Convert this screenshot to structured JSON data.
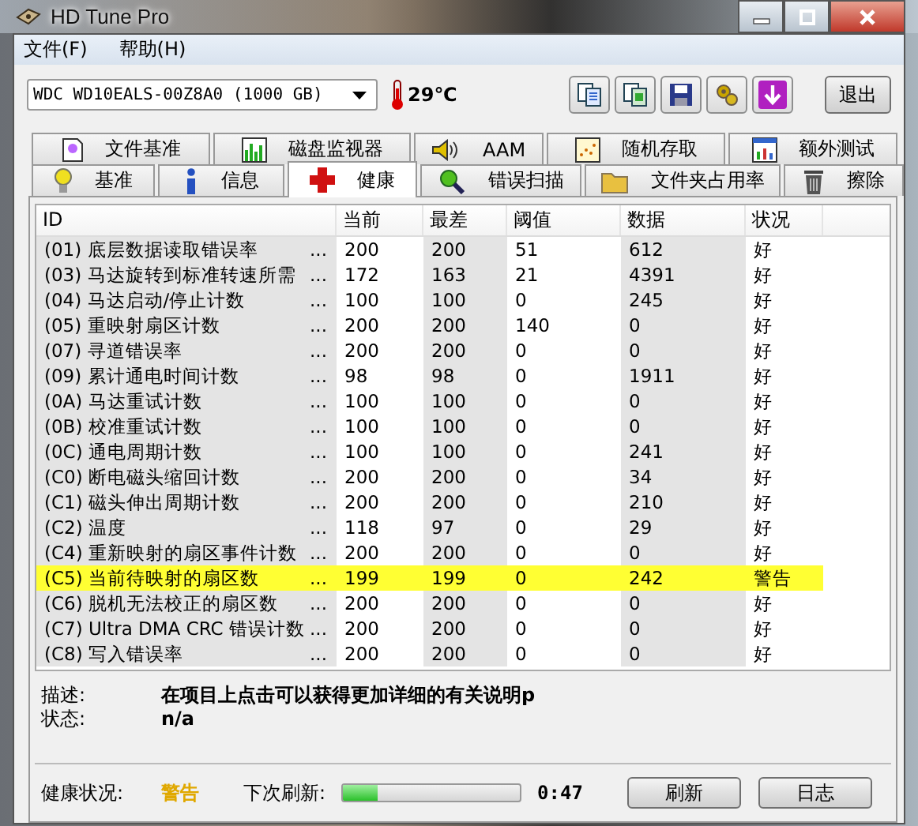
{
  "window": {
    "title": "HD Tune Pro"
  },
  "menu": [
    "文件(F)",
    "帮助(H)"
  ],
  "drive": {
    "value": "WDC WD10EALS-00Z8A0 (1000 GB)"
  },
  "temperature": "29℃",
  "exit_button": "退出",
  "tab_rows": [
    [
      {
        "label": "文件基准",
        "selected": false
      },
      {
        "label": "磁盘监视器",
        "selected": false
      },
      {
        "label": "AAM",
        "selected": false
      },
      {
        "label": "随机存取",
        "selected": false
      },
      {
        "label": "额外测试",
        "selected": false
      }
    ],
    [
      {
        "label": "基准",
        "selected": false
      },
      {
        "label": "信息",
        "selected": false
      },
      {
        "label": "健康",
        "selected": true
      },
      {
        "label": "错误扫描",
        "selected": false
      },
      {
        "label": "文件夹占用率",
        "selected": false
      },
      {
        "label": "擦除",
        "selected": false
      }
    ]
  ],
  "table": {
    "columns": [
      "ID",
      "当前",
      "最差",
      "阈值",
      "数据",
      "状况"
    ],
    "rows": [
      {
        "id": "(01) 底层数据读取错误率",
        "more": "...",
        "current": "200",
        "worst": "200",
        "threshold": "51",
        "data": "612",
        "status": "好",
        "warning": false
      },
      {
        "id": "(03) 马达旋转到标准转速所需",
        "more": "...",
        "current": "172",
        "worst": "163",
        "threshold": "21",
        "data": "4391",
        "status": "好",
        "warning": false
      },
      {
        "id": "(04) 马达启动/停止计数",
        "more": "...",
        "current": "100",
        "worst": "100",
        "threshold": "0",
        "data": "245",
        "status": "好",
        "warning": false
      },
      {
        "id": "(05) 重映射扇区计数",
        "more": "...",
        "current": "200",
        "worst": "200",
        "threshold": "140",
        "data": "0",
        "status": "好",
        "warning": false
      },
      {
        "id": "(07) 寻道错误率",
        "more": "...",
        "current": "200",
        "worst": "200",
        "threshold": "0",
        "data": "0",
        "status": "好",
        "warning": false
      },
      {
        "id": "(09) 累计通电时间计数",
        "more": "...",
        "current": "98",
        "worst": "98",
        "threshold": "0",
        "data": "1911",
        "status": "好",
        "warning": false
      },
      {
        "id": "(0A) 马达重试计数",
        "more": "...",
        "current": "100",
        "worst": "100",
        "threshold": "0",
        "data": "0",
        "status": "好",
        "warning": false
      },
      {
        "id": "(0B) 校准重试计数",
        "more": "...",
        "current": "100",
        "worst": "100",
        "threshold": "0",
        "data": "0",
        "status": "好",
        "warning": false
      },
      {
        "id": "(0C) 通电周期计数",
        "more": "...",
        "current": "100",
        "worst": "100",
        "threshold": "0",
        "data": "241",
        "status": "好",
        "warning": false
      },
      {
        "id": "(C0) 断电磁头缩回计数",
        "more": "...",
        "current": "200",
        "worst": "200",
        "threshold": "0",
        "data": "34",
        "status": "好",
        "warning": false
      },
      {
        "id": "(C1) 磁头伸出周期计数",
        "more": "...",
        "current": "200",
        "worst": "200",
        "threshold": "0",
        "data": "210",
        "status": "好",
        "warning": false
      },
      {
        "id": "(C2) 温度",
        "more": "...",
        "current": "118",
        "worst": "97",
        "threshold": "0",
        "data": "29",
        "status": "好",
        "warning": false
      },
      {
        "id": "(C4) 重新映射的扇区事件计数",
        "more": "...",
        "current": "200",
        "worst": "200",
        "threshold": "0",
        "data": "0",
        "status": "好",
        "warning": false
      },
      {
        "id": "(C5) 当前待映射的扇区数",
        "more": "...",
        "current": "199",
        "worst": "199",
        "threshold": "0",
        "data": "242",
        "status": "警告",
        "warning": true
      },
      {
        "id": "(C6) 脱机无法校正的扇区数",
        "more": "...",
        "current": "200",
        "worst": "200",
        "threshold": "0",
        "data": "0",
        "status": "好",
        "warning": false
      },
      {
        "id": "(C7) Ultra DMA CRC 错误计数",
        "more": "...",
        "current": "200",
        "worst": "200",
        "threshold": "0",
        "data": "0",
        "status": "好",
        "warning": false
      },
      {
        "id": "(C8) 写入错误率",
        "more": "...",
        "current": "200",
        "worst": "200",
        "threshold": "0",
        "data": "0",
        "status": "好",
        "warning": false
      }
    ]
  },
  "details": [
    {
      "label": "描述:",
      "value": "在项目上点击可以获得更加详细的有关说明p"
    },
    {
      "label": "状态:",
      "value": "n/a"
    }
  ],
  "health": {
    "label": "健康状况:",
    "value": "警告",
    "warning": true
  },
  "refresh": {
    "label": "下次刷新:",
    "level": 0.2,
    "time": "0:47"
  },
  "buttons": [
    "刷新",
    "日志"
  ]
}
